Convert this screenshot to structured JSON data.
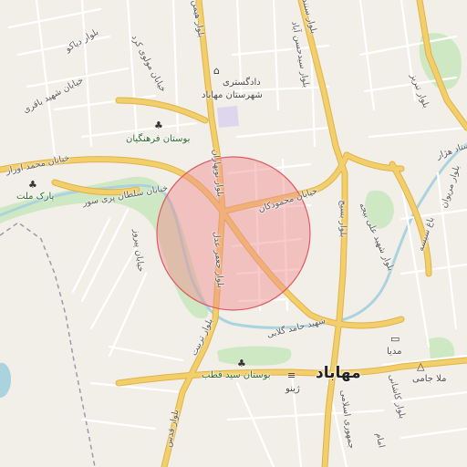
{
  "colors": {
    "land": "#f2efe9",
    "park": "#cfe8c4",
    "water": "#aad3df",
    "major_road": "#f3cf6b",
    "road_casing": "#e0b24a",
    "minor_road": "#ffffff",
    "highlight_fill": "#f08a8f",
    "boundary": "#9a9aa8"
  },
  "labels": {
    "city": "مهاباد",
    "university": "دادگستری",
    "university_sub": "شهرستان مهاباد",
    "park_farhangian": "بوستان فرهنگیان",
    "park_mellat": "پارک ملت",
    "park_seyed_qotb": "بوستان سید قطب",
    "zhino": "ژینو",
    "madia": "مدیا",
    "mala_jami": "ملا جامی",
    "st_mohammad_avaraz": "خیابان محمد اوراز",
    "st_molavi_kord": "خیابان مولوی کرد",
    "blvd_diako": "بلوار دیاکو",
    "blvd_hemin": "بلوار هیمن",
    "blvd_sanandaj": "بلوار سنندج",
    "blvd_sayed_hasan": "بلوار سیدحسن آباد",
    "blvd_nowbahar": "بلوار نوبهاران",
    "st_mahmoudkan": "خیابان محمودکان",
    "st_shahid_bagheri": "خیابان شهید باقری",
    "st_soltan_pari_sor": "خیابان سلطان پری سور",
    "blvd_jafar_adl": "بلوار جعفر عدل",
    "st_pirooz": "خیابان پیروز",
    "blvd_basij": "بلوار بسیج",
    "blvd_ali_bijeh": "بلوار شهید علی بیجه",
    "shahid_golabi": "شهید حامد گلابی",
    "blvd_tarbiat": "بلوار تربیت",
    "blvd_qods": "بلوار قدس",
    "st_jomhouri": "جمهوری اسلامی",
    "st_imam": "امام",
    "blvd_kashani": "بلوار کاشانی",
    "blvd_bagh_sisa": "باغ سیسه",
    "blvd_mariwan": "بلوار مریوان",
    "st_ostad_hazhar": "استاد هژار",
    "st_tabriz": "بلوار تبریز"
  },
  "icons": {
    "university": "university-icon",
    "park_farhangian": "tree-icon",
    "park_mellat": "tree-icon",
    "park_seyed_qotb": "tree-icon",
    "zhino": "cinema-icon",
    "madia": "shop-icon",
    "mala_jami": "peak-icon"
  }
}
